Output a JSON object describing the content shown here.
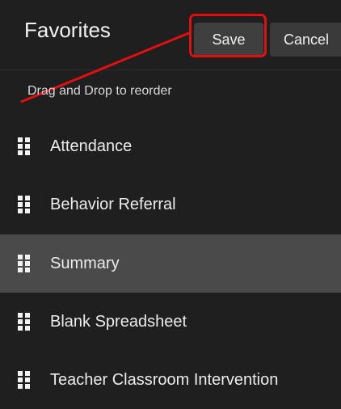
{
  "header": {
    "title": "Favorites",
    "save_label": "Save",
    "cancel_label": "Cancel"
  },
  "hint": "Drag and Drop to reorder",
  "items": [
    {
      "label": "Attendance"
    },
    {
      "label": "Behavior Referral"
    },
    {
      "label": "Summary",
      "active": true
    },
    {
      "label": "Blank Spreadsheet"
    },
    {
      "label": "Teacher Classroom Intervention"
    }
  ],
  "colors": {
    "background": "#1f1f1f",
    "highlight_row": "#4a4a4a",
    "annotation": "#e01010"
  }
}
